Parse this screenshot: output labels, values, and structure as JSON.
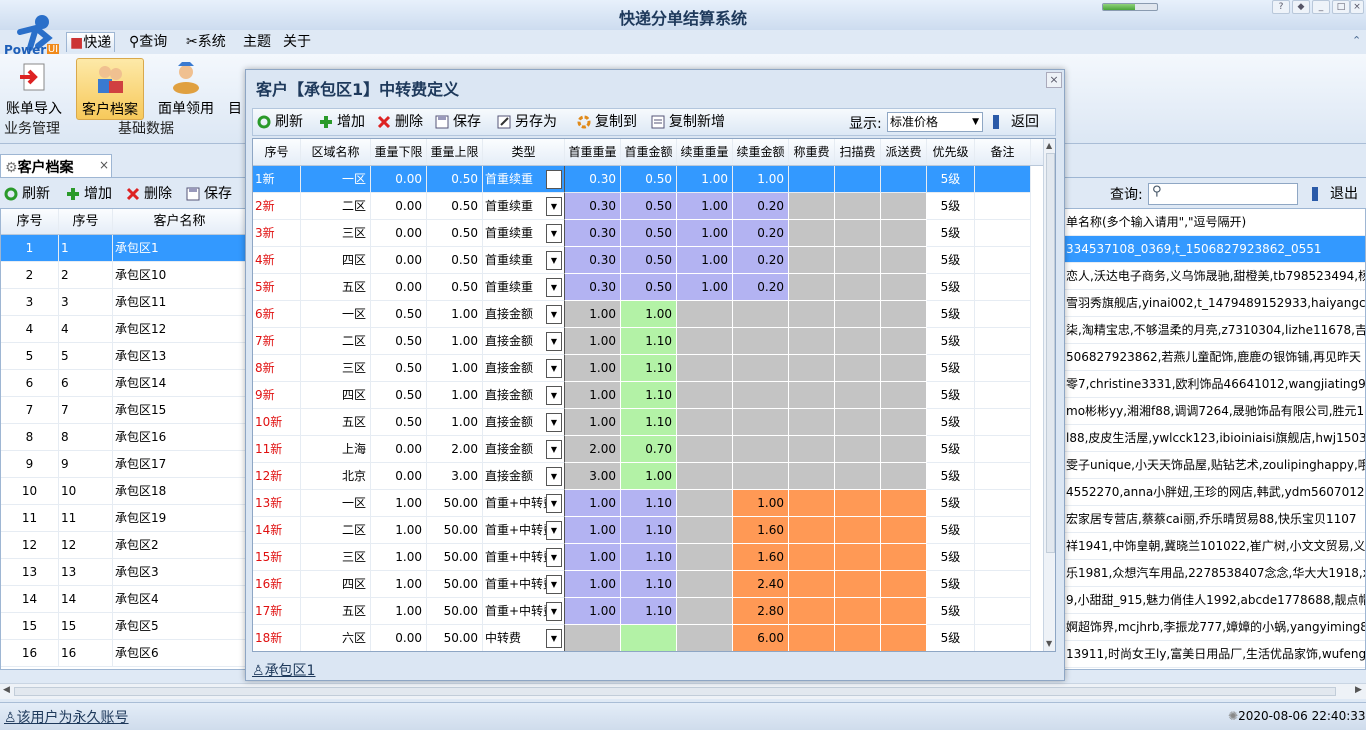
{
  "app": {
    "title": "快递分单结算系统",
    "logo_text": "Power",
    "progress": 0.6
  },
  "menu": [
    "快递",
    "查询",
    "系统",
    "主题",
    "关于"
  ],
  "ribbon": {
    "buttons": [
      "账单导入",
      "客户档案",
      "面单领用",
      "目"
    ],
    "groups": [
      "业务管理",
      "基础数据"
    ]
  },
  "doc_tab": {
    "label": "客户档案",
    "close": "×"
  },
  "toolbar": {
    "refresh": "刷新",
    "add": "增加",
    "delete": "删除",
    "save": "保存"
  },
  "right_toolbar": {
    "search_label": "查询:",
    "exit": "退出"
  },
  "bg_grid": {
    "headers": [
      "序号",
      "序号",
      "客户名称"
    ],
    "rows": [
      [
        "1",
        "1",
        "承包区1"
      ],
      [
        "2",
        "2",
        "承包区10"
      ],
      [
        "3",
        "3",
        "承包区11"
      ],
      [
        "4",
        "4",
        "承包区12"
      ],
      [
        "5",
        "5",
        "承包区13"
      ],
      [
        "6",
        "6",
        "承包区14"
      ],
      [
        "7",
        "7",
        "承包区15"
      ],
      [
        "8",
        "8",
        "承包区16"
      ],
      [
        "9",
        "9",
        "承包区17"
      ],
      [
        "10",
        "10",
        "承包区18"
      ],
      [
        "11",
        "11",
        "承包区19"
      ],
      [
        "12",
        "12",
        "承包区2"
      ],
      [
        "13",
        "13",
        "承包区3"
      ],
      [
        "14",
        "14",
        "承包区4"
      ],
      [
        "15",
        "15",
        "承包区5"
      ],
      [
        "16",
        "16",
        "承包区6"
      ]
    ]
  },
  "right_grid": {
    "header": "单名称(多个输入请用\",\"逗号隔开)",
    "rows": [
      "334537108_0369,t_1506827923862_0551",
      "恋人,沃达电子商务,义乌饰晟驰,甜橙美,tb798523494,杨",
      "雪羽秀旗舰店,yinai002,t_1479489152933,haiyangcap",
      "柒,淘精宝忠,不够温柔的月亮,z7310304,lizhe11678,吉美",
      "506827923862,若燕儿童配饰,鹿鹿の银饰铺,再见昨天",
      "零7,christine3331,欧利饰品46641012,wangjiating9,湘",
      "mo彬彬yy,湘湘f88,调调7264,晟驰饰品有限公司,胜元18",
      "l88,皮皮生活屋,ywlcck123,ibioiniaisi旗舰店,hwj15035",
      "雯子unique,小天天饰品屋,贴钻艺术,zoulipinghappy,哦",
      "4552270,anna小胖妞,王珍的网店,韩武,ydm5607012,",
      "宏家居专营店,蔡蔡cai丽,乔乐晴贸易88,快乐宝贝1107",
      "祥1941,中饰皇朝,冀晓兰101022,崔广树,小文文贸易,义",
      "乐1981,众想汽车用品,2278538407念念,华大大1918,xia",
      "9,小甜甜_915,魅力俏佳人1992,abcde1778688,靓点帽",
      "婀超饰界,mcjhrb,李振龙777,嫜嫜的小蜗,yangyiming85",
      "13911,时尚女王ly,富美日用品厂,生活优品家饰,wufeng4"
    ]
  },
  "status": {
    "account": "该用户为永久账号",
    "datetime": "2020-08-06 22:40:33"
  },
  "dialog": {
    "title": "客户【承包区1】中转费定义",
    "close": "×",
    "toolbar": {
      "refresh": "刷新",
      "add": "增加",
      "delete": "删除",
      "save": "保存",
      "save_as": "另存为",
      "copy_to": "复制到",
      "copy_new": "复制新增",
      "display_label": "显示:",
      "display_value": "标准价格",
      "back": "返回"
    },
    "headers": [
      "序号",
      "区域名称",
      "重量下限",
      "重量上限",
      "类型",
      "首重重量",
      "首重金额",
      "续重重量",
      "续重金额",
      "称重费",
      "扫描费",
      "派送费",
      "优先级",
      "备注"
    ],
    "rows": [
      [
        "1新",
        "一区",
        "0.00",
        "0.50",
        "首重续重",
        "0.30",
        "0.50",
        "1.00",
        "1.00",
        "",
        "",
        "",
        "5级",
        ""
      ],
      [
        "2新",
        "二区",
        "0.00",
        "0.50",
        "首重续重",
        "0.30",
        "0.50",
        "1.00",
        "0.20",
        "",
        "",
        "",
        "5级",
        ""
      ],
      [
        "3新",
        "三区",
        "0.00",
        "0.50",
        "首重续重",
        "0.30",
        "0.50",
        "1.00",
        "0.20",
        "",
        "",
        "",
        "5级",
        ""
      ],
      [
        "4新",
        "四区",
        "0.00",
        "0.50",
        "首重续重",
        "0.30",
        "0.50",
        "1.00",
        "0.20",
        "",
        "",
        "",
        "5级",
        ""
      ],
      [
        "5新",
        "五区",
        "0.00",
        "0.50",
        "首重续重",
        "0.30",
        "0.50",
        "1.00",
        "0.20",
        "",
        "",
        "",
        "5级",
        ""
      ],
      [
        "6新",
        "一区",
        "0.50",
        "1.00",
        "直接金额",
        "1.00",
        "1.00",
        "",
        "",
        "",
        "",
        "",
        "5级",
        ""
      ],
      [
        "7新",
        "二区",
        "0.50",
        "1.00",
        "直接金额",
        "1.00",
        "1.10",
        "",
        "",
        "",
        "",
        "",
        "5级",
        ""
      ],
      [
        "8新",
        "三区",
        "0.50",
        "1.00",
        "直接金额",
        "1.00",
        "1.10",
        "",
        "",
        "",
        "",
        "",
        "5级",
        ""
      ],
      [
        "9新",
        "四区",
        "0.50",
        "1.00",
        "直接金额",
        "1.00",
        "1.10",
        "",
        "",
        "",
        "",
        "",
        "5级",
        ""
      ],
      [
        "10新",
        "五区",
        "0.50",
        "1.00",
        "直接金额",
        "1.00",
        "1.10",
        "",
        "",
        "",
        "",
        "",
        "5级",
        ""
      ],
      [
        "11新",
        "上海",
        "0.00",
        "2.00",
        "直接金额",
        "2.00",
        "0.70",
        "",
        "",
        "",
        "",
        "",
        "5级",
        ""
      ],
      [
        "12新",
        "北京",
        "0.00",
        "3.00",
        "直接金额",
        "3.00",
        "1.00",
        "",
        "",
        "",
        "",
        "",
        "5级",
        ""
      ],
      [
        "13新",
        "一区",
        "1.00",
        "50.00",
        "首重+中转费",
        "1.00",
        "1.10",
        "",
        "1.00",
        "",
        "",
        "",
        "5级",
        ""
      ],
      [
        "14新",
        "二区",
        "1.00",
        "50.00",
        "首重+中转费",
        "1.00",
        "1.10",
        "",
        "1.60",
        "",
        "",
        "",
        "5级",
        ""
      ],
      [
        "15新",
        "三区",
        "1.00",
        "50.00",
        "首重+中转费",
        "1.00",
        "1.10",
        "",
        "1.60",
        "",
        "",
        "",
        "5级",
        ""
      ],
      [
        "16新",
        "四区",
        "1.00",
        "50.00",
        "首重+中转费",
        "1.00",
        "1.10",
        "",
        "2.40",
        "",
        "",
        "",
        "5级",
        ""
      ],
      [
        "17新",
        "五区",
        "1.00",
        "50.00",
        "首重+中转费",
        "1.00",
        "1.10",
        "",
        "2.80",
        "",
        "",
        "",
        "5级",
        ""
      ],
      [
        "18新",
        "六区",
        "0.00",
        "50.00",
        "中转费",
        "",
        "",
        "",
        "6.00",
        "",
        "",
        "",
        "5级",
        ""
      ]
    ],
    "footer": "承包区1"
  },
  "colors": {
    "blue": "#b3b3f2",
    "green": "#b3f2a6",
    "gray": "#c4c4c4",
    "orange": "#ff9955",
    "selected": "#3399ff",
    "red": "#e01010"
  }
}
